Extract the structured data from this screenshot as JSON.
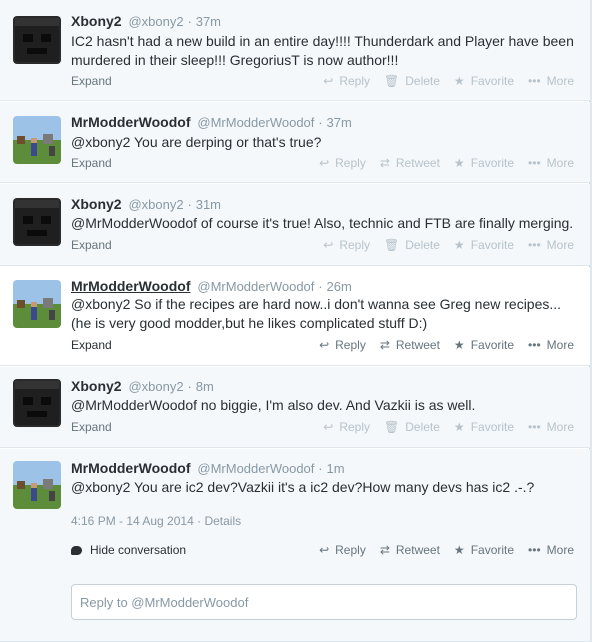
{
  "tweets": [
    {
      "name": "Xbony2",
      "handle": "@xbony2",
      "time": "37m",
      "text": "IC2 hasn't had a new build in an entire day!!!! Thunderdark and Player have been murdered in their sleep!!! GregoriusT is now author!!!",
      "expand": "Expand",
      "actions": [
        "Reply",
        "Delete",
        "Favorite",
        "More"
      ]
    },
    {
      "name": "MrModderWoodof",
      "handle": "@MrModderWoodof",
      "time": "37m",
      "text": "@xbony2 You are derping or that's true?",
      "expand": "Expand",
      "actions": [
        "Reply",
        "Retweet",
        "Favorite",
        "More"
      ]
    },
    {
      "name": "Xbony2",
      "handle": "@xbony2",
      "time": "31m",
      "text": "@MrModderWoodof of course it's true! Also, technic and FTB are finally merging.",
      "expand": "Expand",
      "actions": [
        "Reply",
        "Delete",
        "Favorite",
        "More"
      ]
    },
    {
      "name": "MrModderWoodof",
      "handle": "@MrModderWoodof",
      "time": "26m",
      "text": "@xbony2 So if the recipes are hard now..i don't wanna see Greg new recipes... (he is very good modder,but he likes complicated stuff D:)",
      "expand": "Expand",
      "actions": [
        "Reply",
        "Retweet",
        "Favorite",
        "More"
      ]
    },
    {
      "name": "Xbony2",
      "handle": "@xbony2",
      "time": "8m",
      "text": "@MrModderWoodof no biggie, I'm also dev. And Vazkii is as well.",
      "expand": "Expand",
      "actions": [
        "Reply",
        "Delete",
        "Favorite",
        "More"
      ]
    },
    {
      "name": "MrModderWoodof",
      "handle": "@MrModderWoodof",
      "time": "1m",
      "text": "@xbony2 You are ic2 dev?Vazkii it's a ic2 dev?How many devs has ic2 .-.?",
      "timestamp": "4:16 PM - 14 Aug 2014",
      "details": "Details",
      "hide_conversation": "Hide conversation",
      "actions": [
        "Reply",
        "Retweet",
        "Favorite",
        "More"
      ]
    }
  ],
  "separator": "·",
  "reply_box": {
    "placeholder": "Reply to @MrModderWoodof"
  },
  "colors": {
    "name": "#292f33",
    "meta": "#8899a6",
    "faded_action": "#b6c3cc",
    "border": "#e1e8ed"
  }
}
